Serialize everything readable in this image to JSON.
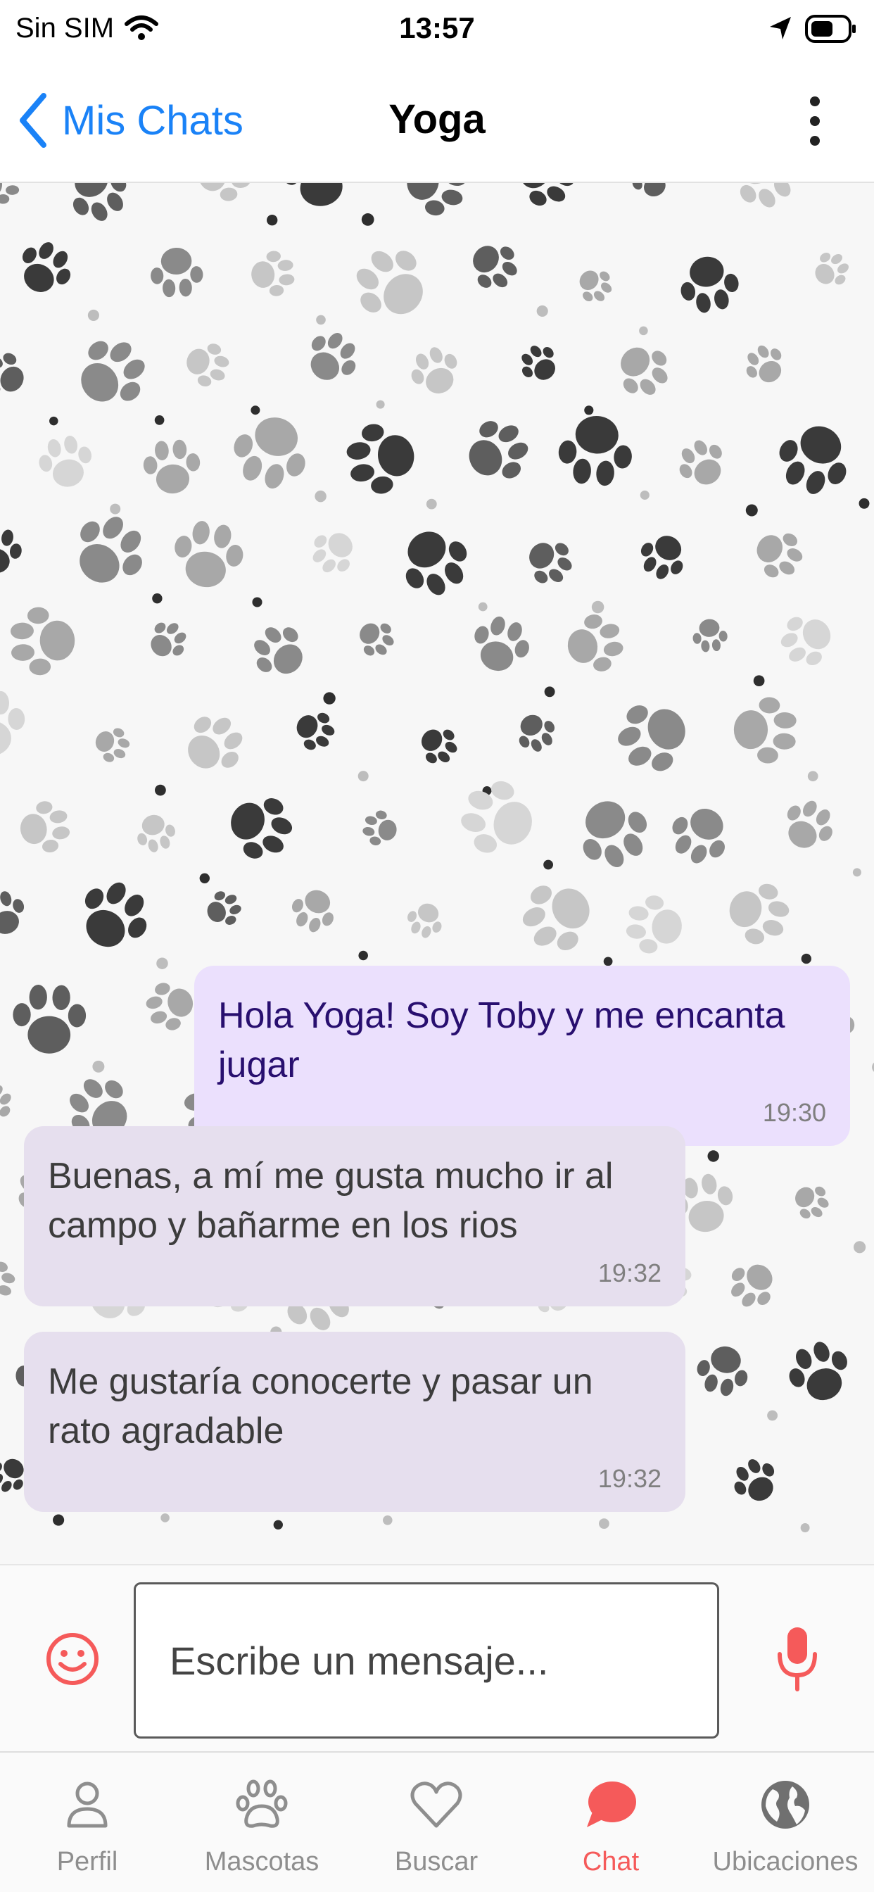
{
  "status_bar": {
    "carrier": "Sin SIM",
    "time": "13:57"
  },
  "nav": {
    "back_label": "Mis Chats",
    "title": "Yoga"
  },
  "messages": [
    {
      "direction": "outgoing",
      "text": "Hola Yoga! Soy Toby y me encanta jugar",
      "time": "19:30"
    },
    {
      "direction": "incoming",
      "text": "Buenas, a mí me gusta mucho ir al campo y bañarme en los rios",
      "time": "19:32"
    },
    {
      "direction": "incoming",
      "text": "Me gustaría conocerte y pasar un rato agradable",
      "time": "19:32"
    }
  ],
  "composer": {
    "placeholder": "Escribe un mensaje...",
    "value": ""
  },
  "tabs": [
    {
      "label": "Perfil",
      "icon": "person-icon",
      "active": false
    },
    {
      "label": "Mascotas",
      "icon": "paw-icon",
      "active": false
    },
    {
      "label": "Buscar",
      "icon": "heart-icon",
      "active": false
    },
    {
      "label": "Chat",
      "icon": "chat-bubble-icon",
      "active": true
    },
    {
      "label": "Ubicaciones",
      "icon": "globe-icon",
      "active": false
    }
  ],
  "colors": {
    "accent_blue": "#1a82f7",
    "accent_red": "#f55a5a",
    "outgoing_bubble": "#ebe0fd",
    "incoming_bubble": "#e6dfee",
    "tab_inactive": "#8e8e8e"
  }
}
